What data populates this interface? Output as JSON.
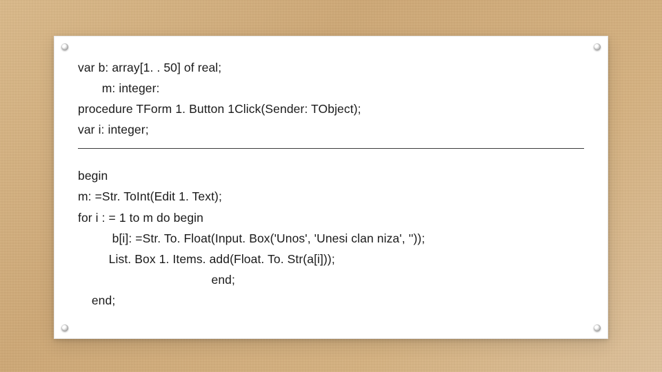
{
  "code": {
    "block1": {
      "l1": "var b: array[1. . 50] of real;",
      "l2": "       m: integer:",
      "l3": "procedure TForm 1. Button 1Click(Sender: TObject);",
      "l4": "var i: integer;"
    },
    "block2": {
      "l1": "begin",
      "l2": "m: =Str. ToInt(Edit 1. Text);",
      "l3": "for i : = 1 to m do begin",
      "l4": "          b[i]: =Str. To. Float(Input. Box('Unos', 'Unesi clan niza', ''));",
      "l5": "         List. Box 1. Items. add(Float. To. Str(a[i]));",
      "l6": "                                       end;",
      "l7": "    end;"
    }
  }
}
